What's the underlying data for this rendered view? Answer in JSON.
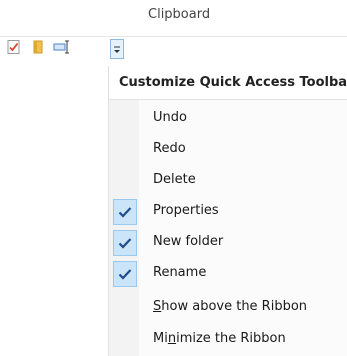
{
  "ribbon": {
    "group_label": "Clipboard"
  },
  "qat": {
    "buttons": [
      {
        "icon": "properties-icon",
        "color": "#d9472b"
      },
      {
        "icon": "new-folder-icon",
        "color": "#f2c14e"
      },
      {
        "icon": "rename-icon",
        "color": "#4a86c8"
      }
    ],
    "dropdown_icon": "customize-dropdown-icon"
  },
  "menu": {
    "header": "Customize Quick Access Toolbar",
    "items": [
      {
        "label": "Undo",
        "checked": false
      },
      {
        "label": "Redo",
        "checked": false
      },
      {
        "label": "Delete",
        "checked": false
      },
      {
        "label": "Properties",
        "checked": true
      },
      {
        "label": "New folder",
        "checked": true
      },
      {
        "label": "Rename",
        "checked": true
      }
    ],
    "show_above": {
      "accel": "S",
      "rest": "how above the Ribbon"
    },
    "minimize": {
      "pre": "Mi",
      "accel": "n",
      "rest": "imize the Ribbon"
    }
  },
  "colors": {
    "check_bg": "#cce4f7",
    "check_mark": "#1e4e8c"
  }
}
